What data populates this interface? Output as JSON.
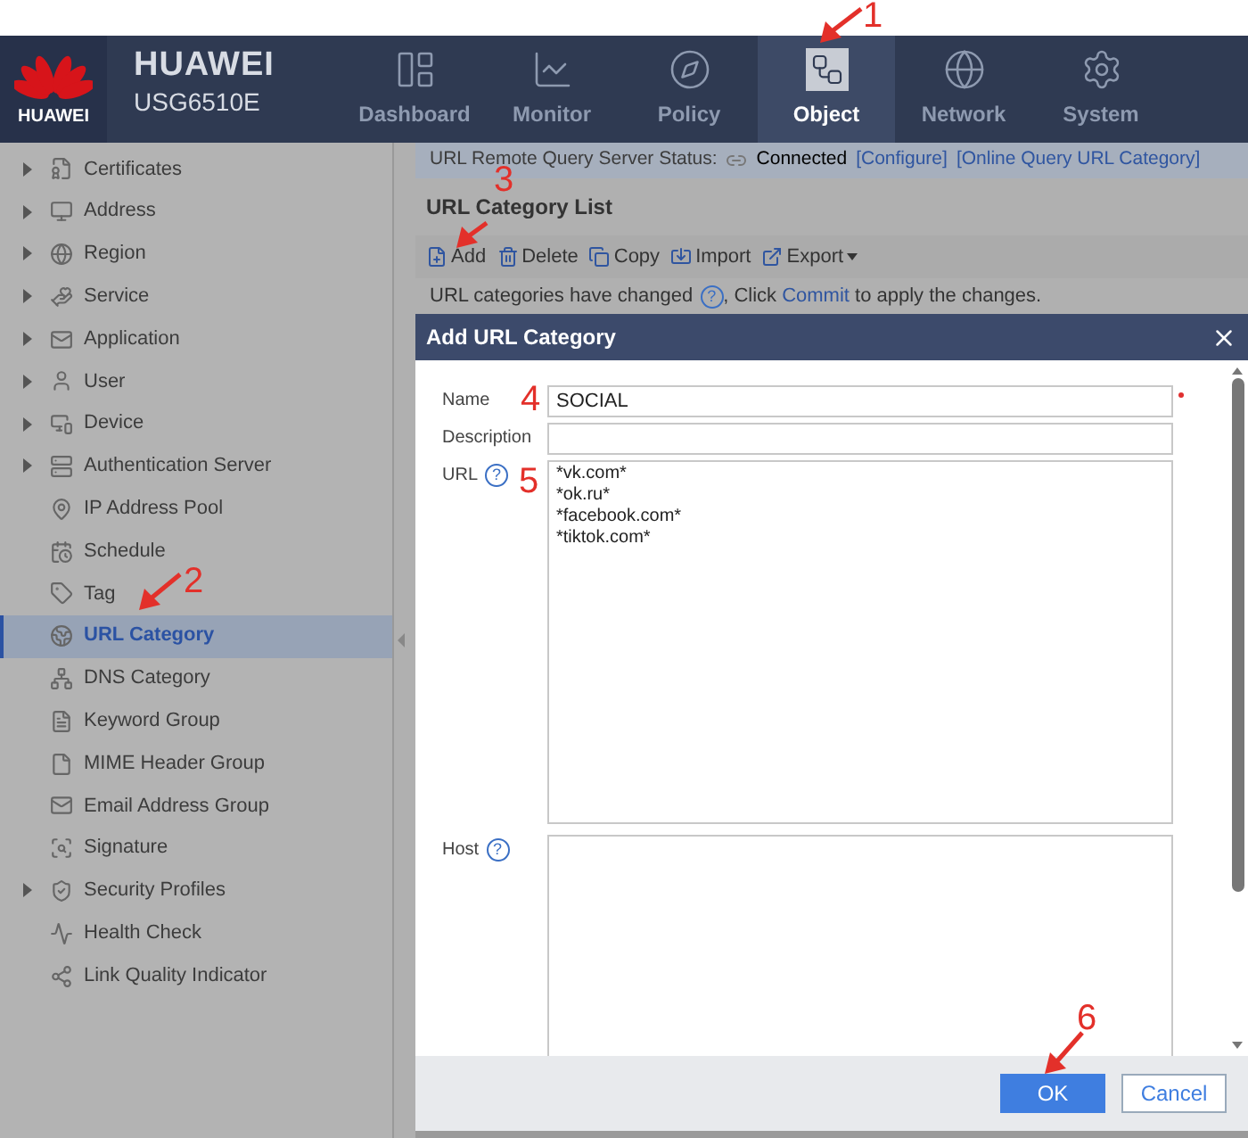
{
  "header": {
    "logo_text": "HUAWEI",
    "brand": "HUAWEI",
    "model": "USG6510E",
    "tabs": [
      {
        "label": "Dashboard",
        "selected": false
      },
      {
        "label": "Monitor",
        "selected": false
      },
      {
        "label": "Policy",
        "selected": false
      },
      {
        "label": "Object",
        "selected": true
      },
      {
        "label": "Network",
        "selected": false
      },
      {
        "label": "System",
        "selected": false
      }
    ]
  },
  "sidebar": {
    "items": [
      {
        "label": "Certificates",
        "expandable": true,
        "selected": false
      },
      {
        "label": "Address",
        "expandable": true,
        "selected": false
      },
      {
        "label": "Region",
        "expandable": true,
        "selected": false
      },
      {
        "label": "Service",
        "expandable": true,
        "selected": false
      },
      {
        "label": "Application",
        "expandable": true,
        "selected": false
      },
      {
        "label": "User",
        "expandable": true,
        "selected": false
      },
      {
        "label": "Device",
        "expandable": true,
        "selected": false
      },
      {
        "label": "Authentication Server",
        "expandable": true,
        "selected": false
      },
      {
        "label": "IP Address Pool",
        "expandable": false,
        "selected": false
      },
      {
        "label": "Schedule",
        "expandable": false,
        "selected": false
      },
      {
        "label": "Tag",
        "expandable": false,
        "selected": false
      },
      {
        "label": "URL Category",
        "expandable": false,
        "selected": true
      },
      {
        "label": "DNS Category",
        "expandable": false,
        "selected": false
      },
      {
        "label": "Keyword Group",
        "expandable": false,
        "selected": false
      },
      {
        "label": "MIME Header Group",
        "expandable": false,
        "selected": false
      },
      {
        "label": "Email Address Group",
        "expandable": false,
        "selected": false
      },
      {
        "label": "Signature",
        "expandable": false,
        "selected": false
      },
      {
        "label": "Security Profiles",
        "expandable": true,
        "selected": false
      },
      {
        "label": "Health Check",
        "expandable": false,
        "selected": false
      },
      {
        "label": "Link Quality Indicator",
        "expandable": false,
        "selected": false
      }
    ]
  },
  "status_bar": {
    "label": "URL Remote Query Server Status:",
    "status": "Connected",
    "links": [
      "[Configure]",
      "[Online Query URL Category]"
    ]
  },
  "list_title": "URL Category List",
  "toolbar": [
    {
      "label": "Add",
      "has_menu": false
    },
    {
      "label": "Delete",
      "has_menu": false
    },
    {
      "label": "Copy",
      "has_menu": false
    },
    {
      "label": "Import",
      "has_menu": false
    },
    {
      "label": "Export",
      "has_menu": true
    }
  ],
  "notice": {
    "before": "URL categories have changed",
    "help": "?",
    "middle": ", Click ",
    "link": "Commit",
    "after": " to apply the changes."
  },
  "dialog": {
    "title": "Add URL Category",
    "fields": [
      {
        "label": "Name",
        "value": "SOCIAL",
        "required": true,
        "kind": "input"
      },
      {
        "label": "Description",
        "required": false,
        "kind": "input"
      },
      {
        "label": "URL",
        "help": "?",
        "lines": [
          "*vk.com*",
          "*ok.ru*",
          "*facebook.com*",
          "*tiktok.com*"
        ],
        "required": false,
        "kind": "textarea"
      },
      {
        "label": "Host",
        "help": "?",
        "required": false,
        "kind": "textarea"
      }
    ],
    "buttons": [
      {
        "label": "OK",
        "primary": true
      },
      {
        "label": "Cancel",
        "primary": false
      }
    ]
  },
  "annotations": [
    {
      "label": "1"
    },
    {
      "label": "2"
    },
    {
      "label": "3"
    },
    {
      "label": "4"
    },
    {
      "label": "5"
    },
    {
      "label": "6"
    }
  ]
}
